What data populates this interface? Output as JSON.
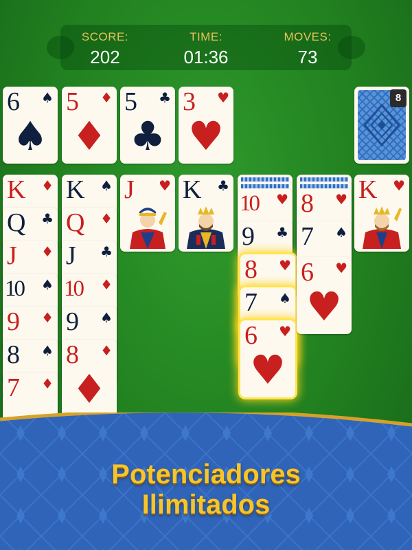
{
  "scoreboard": {
    "score_label": "SCORE:",
    "score_value": "202",
    "time_label": "TIME:",
    "time_value": "01:36",
    "moves_label": "MOVES:",
    "moves_value": "73"
  },
  "foundations": [
    {
      "rank": "6",
      "suit": "♠",
      "color": "black"
    },
    {
      "rank": "5",
      "suit": "♦",
      "color": "red"
    },
    {
      "rank": "5",
      "suit": "♣",
      "color": "black"
    },
    {
      "rank": "3",
      "suit": "♥",
      "color": "red"
    }
  ],
  "stock": {
    "remaining": "8",
    "icon": "card-back-diamond-pattern"
  },
  "tableau": {
    "col1": [
      {
        "rank": "K",
        "suit": "♦"
      },
      {
        "rank": "Q",
        "suit": "♣"
      },
      {
        "rank": "J",
        "suit": "♦"
      },
      {
        "rank": "10",
        "suit": "♠"
      },
      {
        "rank": "9",
        "suit": "♦"
      },
      {
        "rank": "8",
        "suit": "♠"
      },
      {
        "rank": "7",
        "suit": "♦"
      }
    ],
    "col2": [
      {
        "rank": "K",
        "suit": "♠"
      },
      {
        "rank": "Q",
        "suit": "♦"
      },
      {
        "rank": "J",
        "suit": "♣"
      },
      {
        "rank": "10",
        "suit": "♦"
      },
      {
        "rank": "9",
        "suit": "♠"
      },
      {
        "rank": "8",
        "suit": "♦"
      }
    ],
    "col3": [
      {
        "rank": "J",
        "suit": "♥"
      }
    ],
    "col4": [
      {
        "rank": "K",
        "suit": "♣"
      }
    ],
    "col5": [
      {
        "rank": "10",
        "suit": "♥"
      },
      {
        "rank": "9",
        "suit": "♣"
      },
      {
        "rank": "8",
        "suit": "♥"
      },
      {
        "rank": "7",
        "suit": "♠"
      },
      {
        "rank": "6",
        "suit": "♥"
      }
    ],
    "col6": [
      {
        "rank": "8",
        "suit": "♥"
      },
      {
        "rank": "7",
        "suit": "♠"
      },
      {
        "rank": "6",
        "suit": "♥"
      }
    ],
    "col7": [
      {
        "rank": "K",
        "suit": "♥"
      }
    ]
  },
  "colors": {
    "table_green": "#21801f",
    "label_gold": "#e9c25a",
    "red_suit": "#c8201f",
    "black_suit": "#0f1f3d",
    "highlight": "#ffe44d",
    "banner_blue": "#2f64b8",
    "slogan_gold": "#f7c52a"
  },
  "promo": {
    "line1": "Potenciadores",
    "line2": "Ilimitados"
  }
}
